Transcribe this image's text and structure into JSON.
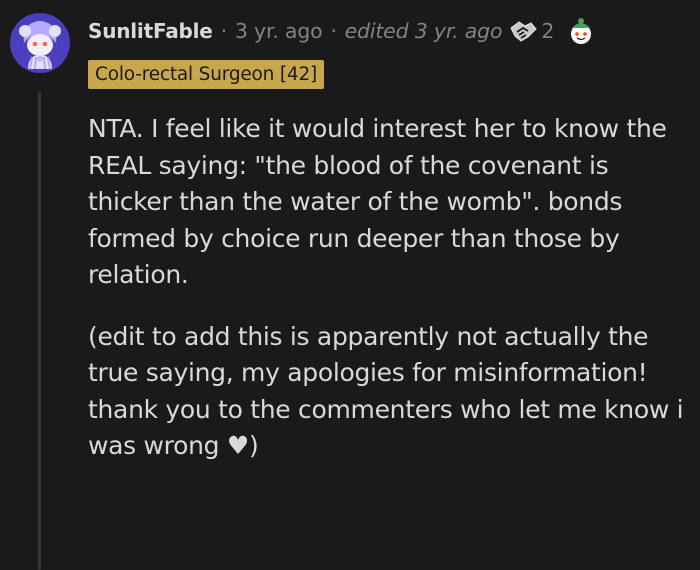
{
  "comment": {
    "username": "SunlitFable",
    "separator": "·",
    "time": "3 yr. ago",
    "edited": "edited 3 yr. ago",
    "award_count": "2",
    "flair": "Colo-rectal Surgeon [42]",
    "paragraphs": [
      "NTA. I feel like it would interest her to know the REAL saying: \"the blood of the covenant is thicker than the water of the womb\". bonds formed by choice run deeper than those by relation.",
      "(edit to add this is apparently not actually the true saying, my apologies for misinformation! thank you to the commenters who let me know i was wrong ♥)"
    ]
  },
  "colors": {
    "background": "#1a1a1b",
    "text": "#d7dadc",
    "meta": "#818384",
    "flair_background": "#c8a74c",
    "avatar_background": "#4a3fbf"
  },
  "icons": {
    "avatar": "snoo-avatar",
    "award_1": "handshake-award-icon",
    "award_2": "snoo-award-icon"
  }
}
